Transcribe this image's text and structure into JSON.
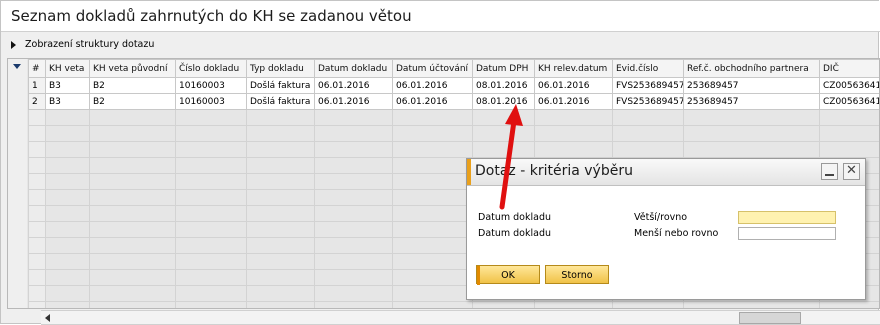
{
  "window": {
    "title": "Seznam dokladů zahrnutých do KH se zadanou větou"
  },
  "structure_toggle": {
    "label": "Zobrazení struktury dotazu"
  },
  "grid": {
    "columns": [
      "#",
      "KH veta",
      "KH veta původní",
      "Číslo dokladu",
      "Typ dokladu",
      "Datum dokladu",
      "Datum účtování",
      "Datum DPH",
      "KH relev.datum",
      "Evid.číslo",
      "Ref.č. obchodního partnera",
      "DIČ"
    ],
    "rows": [
      [
        "1",
        "B3",
        "B2",
        "10160003",
        "Došlá faktura",
        "06.01.2016",
        "06.01.2016",
        "08.01.2016",
        "06.01.2016",
        "FVS253689457",
        "253689457",
        "CZ00563641"
      ],
      [
        "2",
        "B3",
        "B2",
        "10160003",
        "Došlá faktura",
        "06.01.2016",
        "06.01.2016",
        "08.01.2016",
        "06.01.2016",
        "FVS253689457",
        "253689457",
        "CZ00563641"
      ]
    ]
  },
  "dialog": {
    "title": "Dotaz - kritéria výběru",
    "criteria": [
      {
        "field": "Datum dokladu",
        "operator": "Větší/rovno",
        "value": ""
      },
      {
        "field": "Datum dokladu",
        "operator": "Menší nebo rovno",
        "value": ""
      }
    ],
    "ok_label": "OK",
    "cancel_label": "Storno"
  },
  "colors": {
    "accent": "#f0c248",
    "annotation": "#e01010"
  }
}
